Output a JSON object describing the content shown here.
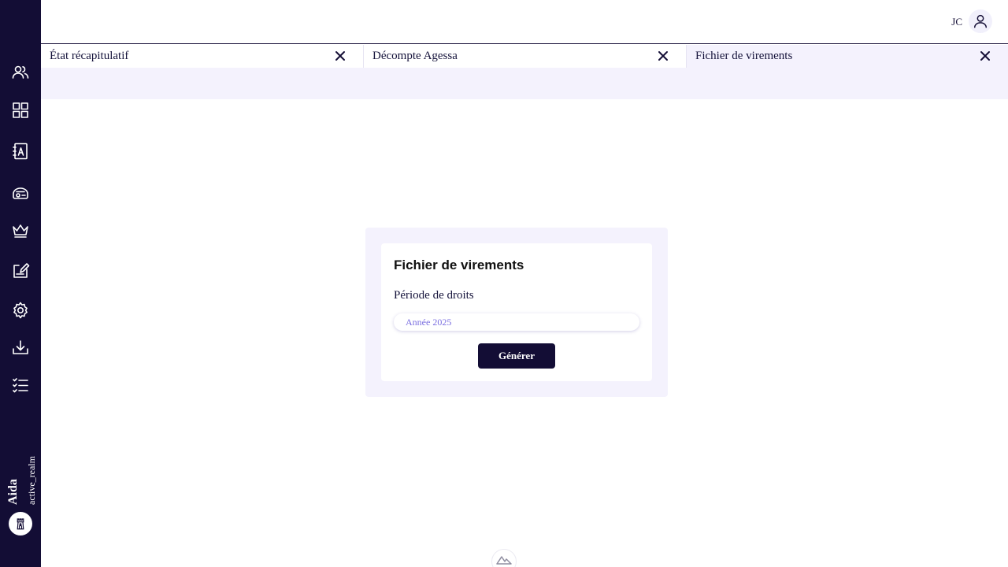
{
  "sidebar": {
    "icons": [
      "users-icon",
      "dashboard-grid-icon",
      "contacts-book-icon",
      "cash-register-icon",
      "crown-icon",
      "edit-document-icon",
      "settings-gear-icon",
      "download-tray-icon",
      "checklist-icon"
    ],
    "brand_name": "Aida",
    "realm": "active_realm",
    "logo_icon": "tower-logo-icon",
    "background_color": "#130d35"
  },
  "header": {
    "user_initials": "JC",
    "user_icon": "user-account-icon"
  },
  "tabs": [
    {
      "label": "État récapitulatif",
      "active": false
    },
    {
      "label": "Décompte Agessa",
      "active": false
    },
    {
      "label": "Fichier de virements",
      "active": true
    }
  ],
  "form": {
    "title": "Fichier de virements",
    "period_label": "Période de droits",
    "period_value": "Année 2025",
    "generate_label": "Générer"
  },
  "footer": {
    "indicator_icon": "nuxt-mountain-icon"
  },
  "colors": {
    "primary": "#130d35",
    "tab_active_bg": "#f4f2fd",
    "input_text": "#7a6ee0"
  }
}
